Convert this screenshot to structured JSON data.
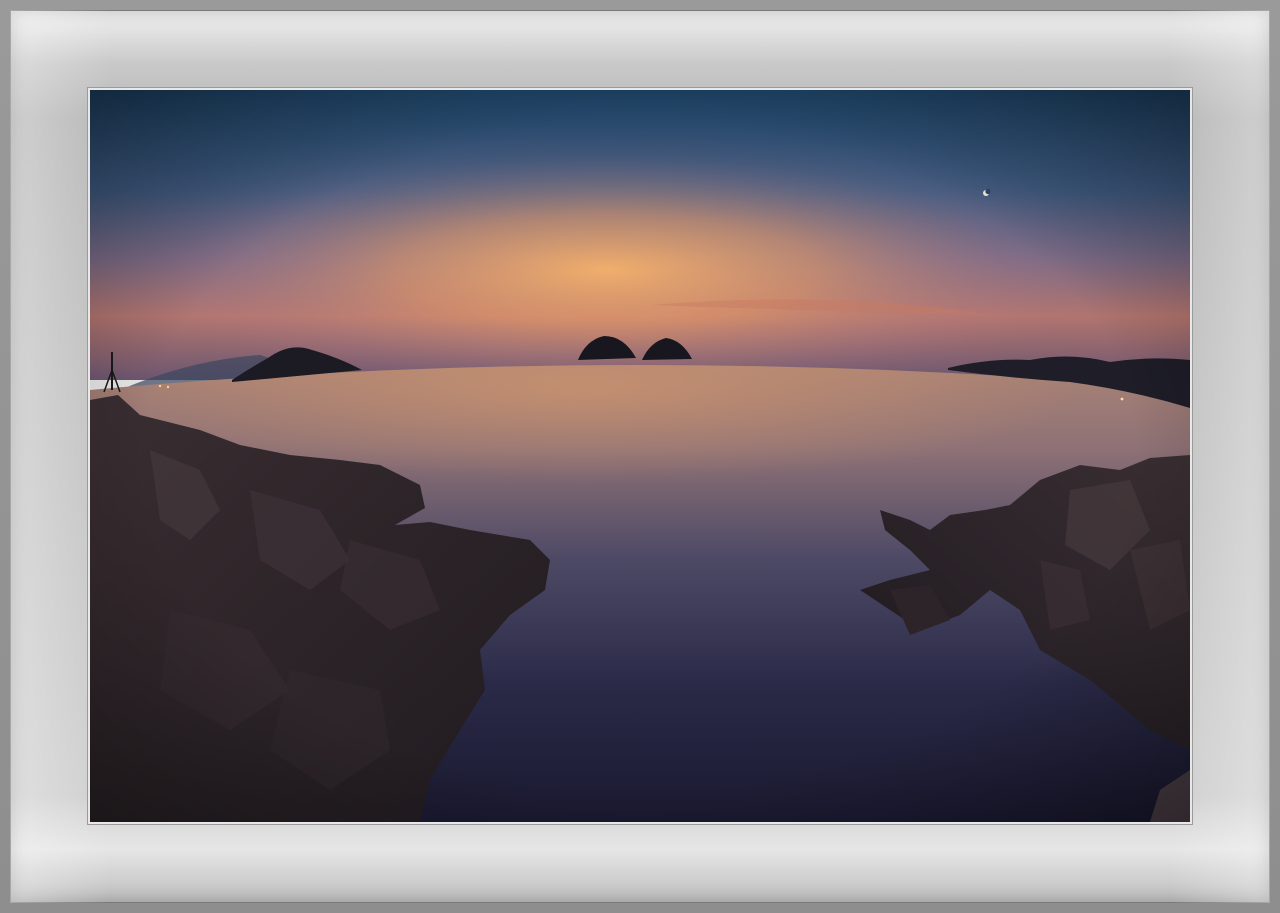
{
  "image": {
    "kind": "framed-photograph",
    "scene": [
      "sunset-sky",
      "crescent-moon",
      "sea",
      "twin-islets",
      "left-island",
      "right-headland",
      "left-rocky-shore",
      "right-rocky-shore"
    ],
    "colors": {
      "frame": "#8e8e8e",
      "mat_light": "#f2f2f2",
      "mat_mid": "#c2c2c2",
      "sky_top": "#1f4466",
      "sky_mid": "#4a5f84",
      "glow_orange": "#f0a860",
      "horizon_red": "#c86a4a",
      "sea_surface": "#b6866e",
      "sea_deep": "#1d1a33",
      "rock": "#2b2326"
    }
  }
}
